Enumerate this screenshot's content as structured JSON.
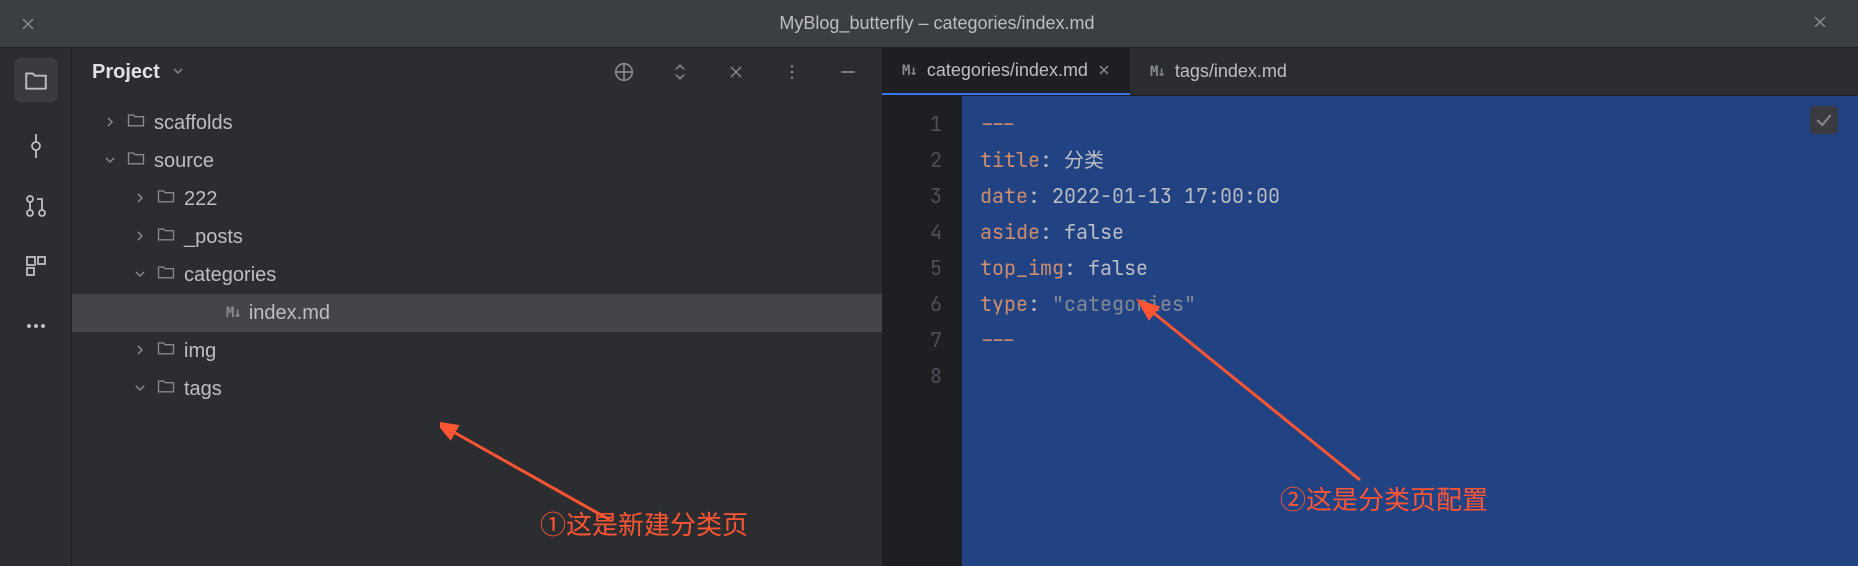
{
  "window": {
    "title": "MyBlog_butterfly – categories/index.md"
  },
  "project_panel": {
    "title": "Project"
  },
  "tree": {
    "items": [
      {
        "label": "scaffolds",
        "type": "folder",
        "expand": "collapsed",
        "indent": 0
      },
      {
        "label": "source",
        "type": "folder",
        "expand": "expanded",
        "indent": 0
      },
      {
        "label": "222",
        "type": "folder",
        "expand": "collapsed",
        "indent": 1
      },
      {
        "label": "_posts",
        "type": "folder",
        "expand": "collapsed",
        "indent": 1
      },
      {
        "label": "categories",
        "type": "folder",
        "expand": "expanded",
        "indent": 1
      },
      {
        "label": "index.md",
        "type": "md",
        "expand": null,
        "indent": 3,
        "selected": true
      },
      {
        "label": "img",
        "type": "folder",
        "expand": "collapsed",
        "indent": 1
      },
      {
        "label": "tags",
        "type": "folder",
        "expand": "expanded",
        "indent": 1
      }
    ]
  },
  "tabs": [
    {
      "label": "categories/index.md",
      "active": true
    },
    {
      "label": "tags/index.md",
      "active": false
    }
  ],
  "gutter": [
    "1",
    "2",
    "3",
    "4",
    "5",
    "6",
    "7",
    "8"
  ],
  "code": {
    "marker": "---",
    "l2_key": "title",
    "l2_val": "分类",
    "l3_key": "date",
    "l3_val": "2022-01-13 17:00:00",
    "l4_key": "aside",
    "l4_val": "false",
    "l5_key": "top_img",
    "l5_val": "false",
    "l6_key": "type",
    "l6_val": "\"categories\""
  },
  "annotations": {
    "a1": "①这是新建分类页",
    "a2": "②这是分类页配置"
  }
}
